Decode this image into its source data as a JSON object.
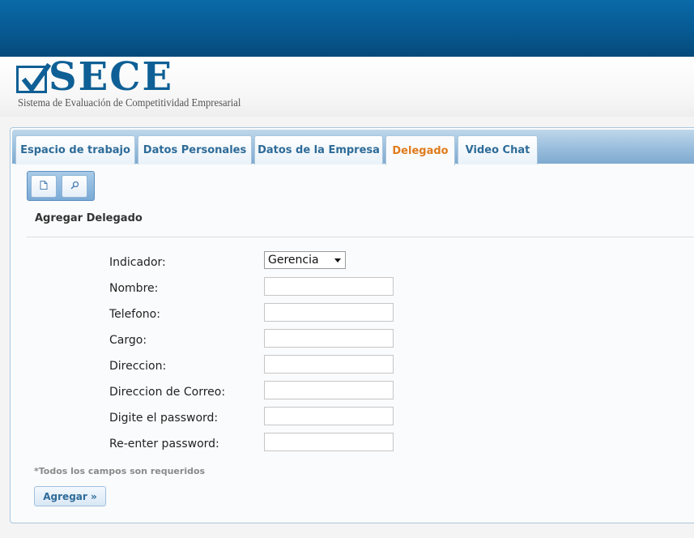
{
  "header": {
    "logo_text": "SECE",
    "logo_subtitle": "Sistema de Evaluación de Competitividad Empresarial"
  },
  "tabs": [
    {
      "label": "Espacio de trabajo",
      "active": false
    },
    {
      "label": "Datos Personales",
      "active": false
    },
    {
      "label": "Datos de la Empresa",
      "active": false
    },
    {
      "label": "Delegado",
      "active": true
    },
    {
      "label": "Video Chat",
      "active": false
    }
  ],
  "toolbar": {
    "buttons": [
      {
        "icon": "document-icon"
      },
      {
        "icon": "search-icon"
      }
    ]
  },
  "form": {
    "title": "Agregar Delegado",
    "indicator": {
      "label": "Indicador:",
      "value": "Gerencia"
    },
    "fields": [
      {
        "label": "Nombre:",
        "value": ""
      },
      {
        "label": "Telefono:",
        "value": ""
      },
      {
        "label": "Cargo:",
        "value": ""
      },
      {
        "label": "Direccion:",
        "value": ""
      },
      {
        "label": "Direccion de Correo:",
        "value": ""
      },
      {
        "label": "Digite el password:",
        "value": ""
      },
      {
        "label": "Re-enter password:",
        "value": ""
      }
    ],
    "required_note": "*Todos los campos son requeridos",
    "submit_label": "Agregar »"
  },
  "colors": {
    "header_blue": "#07588f",
    "brand_blue": "#0e5f95",
    "tab_text": "#2e6b98",
    "active_tab_text": "#e07b1c"
  }
}
